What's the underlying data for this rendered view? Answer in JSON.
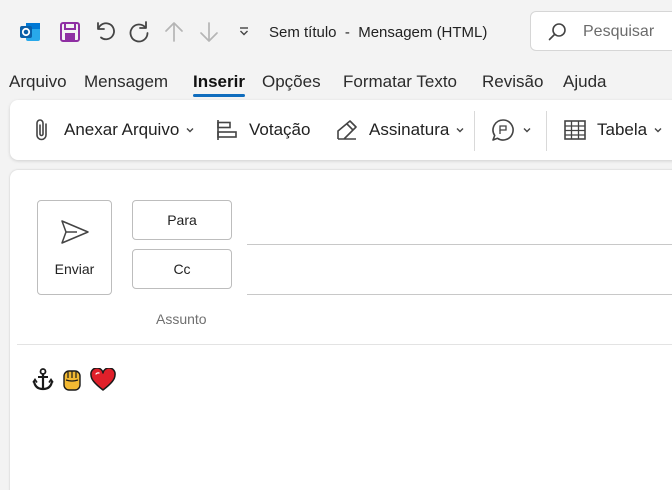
{
  "titlebar": {
    "title": "Sem título  -  Mensagem (HTML)",
    "icons": [
      "outlook-icon",
      "save-icon",
      "undo-icon",
      "redo-icon",
      "up-arrow-icon",
      "down-arrow-icon",
      "customize-chevron-icon"
    ]
  },
  "search": {
    "placeholder": "Pesquisar"
  },
  "tabs": [
    {
      "label": "Arquivo"
    },
    {
      "label": "Mensagem"
    },
    {
      "label": "Inserir",
      "active": true
    },
    {
      "label": "Opções"
    },
    {
      "label": "Formatar Texto"
    },
    {
      "label": "Revisão"
    },
    {
      "label": "Ajuda"
    }
  ],
  "ribbon": {
    "attach": "Anexar Arquivo",
    "poll": "Votação",
    "signature": "Assinatura",
    "table": "Tabela"
  },
  "compose": {
    "send": "Enviar",
    "to": "Para",
    "cc": "Cc",
    "subject": "Assunto"
  },
  "body": {
    "emojis": [
      "anchor",
      "raised-fist",
      "red-heart"
    ]
  },
  "colors": {
    "accent": "#0f6cbd",
    "save_purple": "#8f2fa3",
    "heart": "#e0202a",
    "fist": "#f2b933"
  }
}
